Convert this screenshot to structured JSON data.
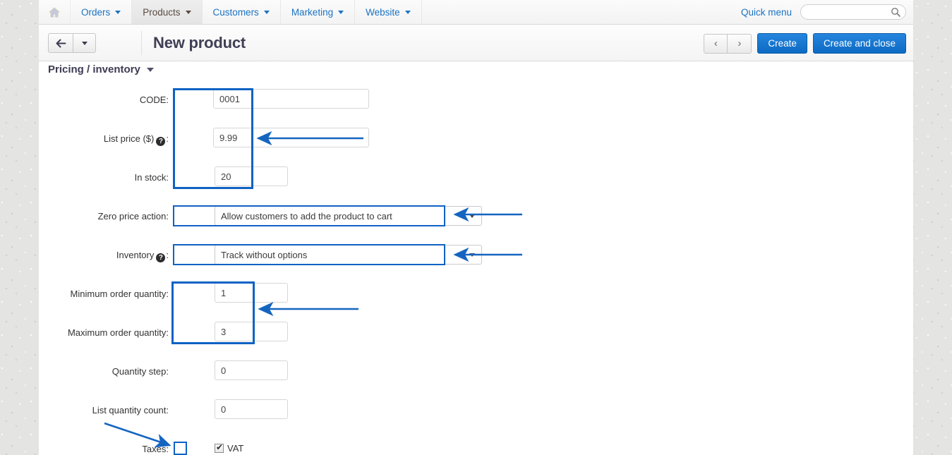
{
  "topnav": {
    "home_icon": "home-icon",
    "items": [
      {
        "label": "Orders",
        "active": false
      },
      {
        "label": "Products",
        "active": true
      },
      {
        "label": "Customers",
        "active": false
      },
      {
        "label": "Marketing",
        "active": false
      },
      {
        "label": "Website",
        "active": false
      }
    ],
    "quick_menu_label": "Quick menu",
    "search_value": "",
    "search_placeholder": "",
    "search_icon": "search-icon"
  },
  "header": {
    "back_icon": "arrow-left-icon",
    "back_dropdown_icon": "chevron-down-icon",
    "title": "New product",
    "prev_icon": "chevron-left-icon",
    "next_icon": "chevron-right-icon",
    "create_label": "Create",
    "create_and_close_label": "Create and close"
  },
  "section": {
    "title": "Pricing / inventory",
    "collapse_icon": "chevron-down-icon"
  },
  "form": {
    "code": {
      "label": "CODE:",
      "value": "0001",
      "placeholder": ""
    },
    "list_price": {
      "label": "List price ($)",
      "label_suffix": ":",
      "help_icon": "help-icon",
      "help_glyph": "?",
      "value": "9.99",
      "placeholder": ""
    },
    "in_stock": {
      "label": "In stock:",
      "value": "20",
      "placeholder": ""
    },
    "zero_price_action": {
      "label": "Zero price action:",
      "value": "Allow customers to add the product to cart",
      "caret_icon": "chevron-down-icon"
    },
    "inventory": {
      "label": "Inventory",
      "label_suffix": ":",
      "help_icon": "help-icon",
      "help_glyph": "?",
      "value": "Track without options",
      "caret_icon": "chevron-down-icon"
    },
    "minimum_order_quantity": {
      "label": "Minimum order quantity:",
      "value": "1",
      "placeholder": ""
    },
    "maximum_order_quantity": {
      "label": "Maximum order quantity:",
      "value": "3",
      "placeholder": ""
    },
    "quantity_step": {
      "label": "Quantity step:",
      "value": "0",
      "placeholder": ""
    },
    "list_quantity_count": {
      "label": "List quantity count:",
      "value": "0",
      "placeholder": ""
    },
    "taxes": {
      "label": "Taxes:",
      "checkbox_label": "VAT",
      "checked": true,
      "check_glyph": "✔"
    }
  },
  "annotations": {
    "highlight_color": "#0f62c4",
    "arrow_color": "#1565c0",
    "boxes": [
      {
        "name": "price-block-highlight",
        "target": "code / list price / in stock"
      },
      {
        "name": "zero-price-action-highlight",
        "target": "zero price action select"
      },
      {
        "name": "inventory-highlight",
        "target": "inventory select"
      },
      {
        "name": "order-quantity-highlight",
        "target": "minimum and maximum order quantity"
      },
      {
        "name": "taxes-checkbox-highlight",
        "target": "VAT checkbox"
      }
    ],
    "arrows": [
      {
        "name": "arrow-to-list-price",
        "direction": "left"
      },
      {
        "name": "arrow-to-zero-price-action",
        "direction": "left"
      },
      {
        "name": "arrow-to-inventory",
        "direction": "left"
      },
      {
        "name": "arrow-to-order-quantity",
        "direction": "left"
      },
      {
        "name": "arrow-to-taxes-checkbox",
        "direction": "down-right"
      }
    ]
  }
}
